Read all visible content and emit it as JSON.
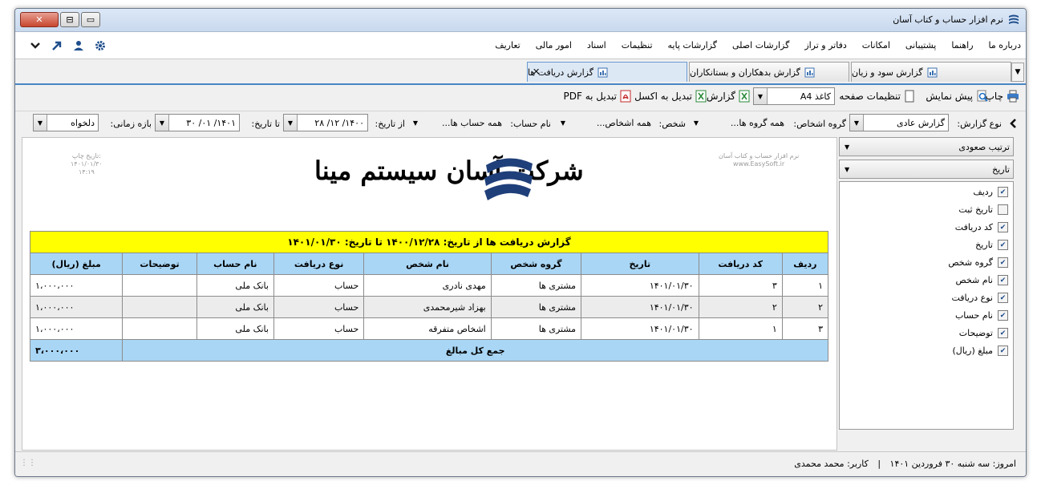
{
  "window": {
    "title": "نرم افزار حساب و کتاب آسان",
    "controls": {
      "minimize": "▭",
      "maximize": "⊟",
      "close": "✕"
    }
  },
  "menu": {
    "items": [
      "تعاریف",
      "امور مالی",
      "اسناد",
      "تنظیمات",
      "گزارشات پایه",
      "گزارشات اصلی",
      "دفاتر و تراز",
      "امکانات",
      "پشتیبانی",
      "راهنما",
      "درباره ما"
    ],
    "toolbar_icons": [
      "settings-icon",
      "user-icon",
      "arrow-icon",
      "chevron-down-icon"
    ],
    "accent": "#1f4e8c"
  },
  "tabs": {
    "items": [
      {
        "label": "گزارش سود و زیان",
        "active": false
      },
      {
        "label": "گزارش بدهکاران و بستانکاران",
        "active": false
      },
      {
        "label": "گزارش دریافت ها",
        "active": true
      }
    ],
    "close_glyph": "✕",
    "arrow": "▼"
  },
  "toolbar": {
    "print": "چاپ",
    "preview": "پیش نمایش",
    "page_settings": "تنظیمات صفحه",
    "paper_label": "کاغذ",
    "paper_value": "A4",
    "report": "گزارش",
    "to_excel": "تبدیل به اکسل",
    "to_pdf": "تبدیل به PDF"
  },
  "filters": {
    "report_type_label": "نوع گزارش:",
    "report_type_value": "گزارش عادی",
    "group_label": "گروه اشخاص:",
    "group_value": "همه گروه ها...",
    "person_label": "شخص:",
    "person_value": "همه اشخاص...",
    "account_label": "نام حساب:",
    "account_value": "همه حساب ها...",
    "from_label": "از تاریخ:",
    "from_value": "۱۴۰۰/ ۱۲/ ۲۸",
    "to_label": "تا تاریخ:",
    "to_value": "۱۴۰۱/ ۰۱/ ۳۰",
    "period_label": "بازه زمانی:",
    "period_value": "دلخواه"
  },
  "report": {
    "print_date_label": "تاریخ چاپ:",
    "print_date": "۱۴۰۱/۰۱/۳۰",
    "print_time": "۱۴:۱۹",
    "software_name": "نرم افزار حساب و کتاب آسان",
    "website": "www.EasySoft.ir",
    "company": "شرکت آسان سیستم مینا",
    "title": "گزارش دریافت ها از تاریخ: ۱۴۰۰/۱۲/۲۸ تا تاریخ: ۱۴۰۱/۰۱/۳۰",
    "columns": [
      "ردیف",
      "کد دریافت",
      "تاریخ",
      "گروه شخص",
      "نام شخص",
      "نوع دریافت",
      "نام حساب",
      "توضیحات",
      "مبلغ (ریال)"
    ],
    "rows": [
      [
        "۱",
        "۳",
        "۱۴۰۱/۰۱/۳۰",
        "مشتری ها",
        "مهدی نادری",
        "حساب",
        "بانک ملی",
        "",
        "۱،۰۰۰،۰۰۰"
      ],
      [
        "۲",
        "۲",
        "۱۴۰۱/۰۱/۳۰",
        "مشتری ها",
        "بهزاد شیرمحمدی",
        "حساب",
        "بانک ملی",
        "",
        "۱،۰۰۰،۰۰۰"
      ],
      [
        "۳",
        "۱",
        "۱۴۰۱/۰۱/۳۰",
        "مشتری ها",
        "اشخاص متفرقه",
        "حساب",
        "بانک ملی",
        "",
        "۱،۰۰۰،۰۰۰"
      ]
    ],
    "total_label": "جمع کل مبالغ",
    "total_value": "۳،۰۰۰،۰۰۰",
    "colors": {
      "title_bg": "#ffff00",
      "header_bg": "#a9d6f5",
      "alt_row": "#ececec"
    }
  },
  "side": {
    "sort_value": "ترتیب صعودی",
    "sort_by_value": "تاریخ",
    "columns": [
      {
        "label": "ردیف",
        "checked": true
      },
      {
        "label": "تاریخ ثبت",
        "checked": false
      },
      {
        "label": "کد دریافت",
        "checked": true
      },
      {
        "label": "تاریخ",
        "checked": true
      },
      {
        "label": "گروه شخص",
        "checked": true
      },
      {
        "label": "نام شخص",
        "checked": true
      },
      {
        "label": "نوع دریافت",
        "checked": true
      },
      {
        "label": "نام حساب",
        "checked": true
      },
      {
        "label": "توضیحات",
        "checked": true
      },
      {
        "label": "مبلغ (ریال)",
        "checked": true
      }
    ]
  },
  "status": {
    "today": "امروز: سه شنبه ۳۰ فروردین ۱۴۰۱",
    "separator": "|",
    "user": "کاربر: محمد محمدی"
  }
}
